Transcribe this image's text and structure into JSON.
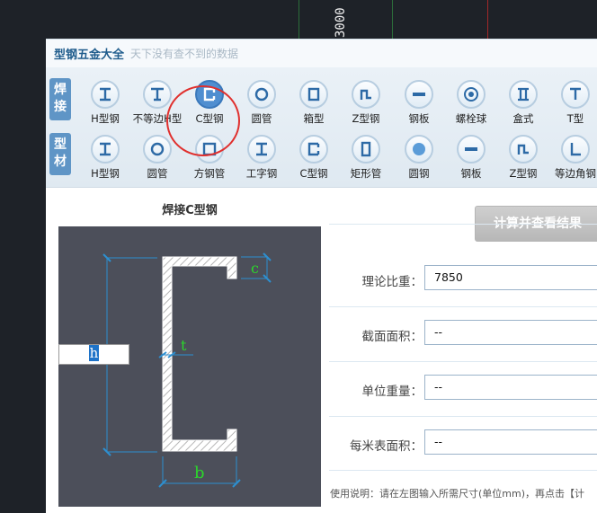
{
  "cad": {
    "dimension_text": "3000"
  },
  "app": {
    "title": "型钢五金大全",
    "subtitle": "天下没有查不到的数据"
  },
  "categories": {
    "weld": "焊接",
    "profile": "型材"
  },
  "weld_tools": [
    {
      "label": "H型钢",
      "icon": "h-beam-icon"
    },
    {
      "label": "不等边H型",
      "icon": "unequal-h-beam-icon"
    },
    {
      "label": "C型钢",
      "icon": "c-channel-icon"
    },
    {
      "label": "圆管",
      "icon": "round-tube-icon"
    },
    {
      "label": "箱型",
      "icon": "box-section-icon"
    },
    {
      "label": "Z型钢",
      "icon": "z-section-icon"
    },
    {
      "label": "钢板",
      "icon": "steel-plate-icon"
    },
    {
      "label": "螺栓球",
      "icon": "bolt-ball-icon"
    },
    {
      "label": "盒式",
      "icon": "box-type-icon"
    },
    {
      "label": "T型",
      "icon": "t-section-icon"
    }
  ],
  "profile_tools": [
    {
      "label": "H型钢",
      "icon": "h-beam-icon"
    },
    {
      "label": "圆管",
      "icon": "round-tube-icon"
    },
    {
      "label": "方钢管",
      "icon": "square-tube-icon"
    },
    {
      "label": "工字钢",
      "icon": "i-beam-icon"
    },
    {
      "label": "C型钢",
      "icon": "c-channel-icon"
    },
    {
      "label": "矩形管",
      "icon": "rect-tube-icon"
    },
    {
      "label": "圆钢",
      "icon": "round-bar-icon"
    },
    {
      "label": "钢板",
      "icon": "steel-plate-icon"
    },
    {
      "label": "Z型钢",
      "icon": "z-section-icon"
    },
    {
      "label": "等边角钢",
      "icon": "equal-angle-icon"
    }
  ],
  "diagram": {
    "title": "焊接C型钢",
    "dim_c": "c",
    "dim_t": "t",
    "dim_b": "b",
    "dim_h": "h"
  },
  "calc": {
    "button": "计算并查看结果",
    "fields": [
      {
        "label": "理论比重：",
        "value": "7850"
      },
      {
        "label": "截面面积：",
        "value": "--"
      },
      {
        "label": "单位重量：",
        "value": "--"
      },
      {
        "label": "每米表面积：",
        "value": "--"
      }
    ],
    "usage": "使用说明：请在左图输入所需尺寸(单位mm)，再点击【计"
  },
  "colors": {
    "accent": "#4f8ed0",
    "highlight_circle": "#e0302e",
    "diagram_bg": "#4c4f5a"
  }
}
